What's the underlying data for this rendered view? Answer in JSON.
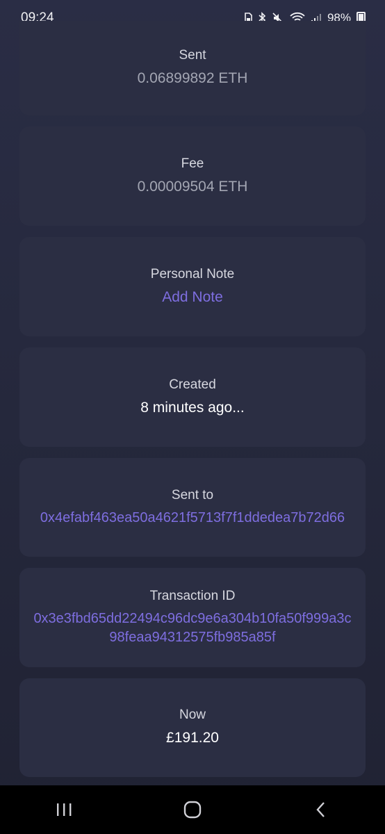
{
  "status_bar": {
    "time": "09:24",
    "battery": "98%"
  },
  "cards": {
    "sent": {
      "label": "Sent",
      "value": "0.06899892 ETH"
    },
    "fee": {
      "label": "Fee",
      "value": "0.00009504 ETH"
    },
    "note": {
      "label": "Personal Note",
      "value": "Add Note"
    },
    "created": {
      "label": "Created",
      "value": "8 minutes ago..."
    },
    "sent_to": {
      "label": "Sent to",
      "value": "0x4efabf463ea50a4621f5713f7f1ddedea7b72d66"
    },
    "tx_id": {
      "label": "Transaction ID",
      "value": "0x3e3fbd65dd22494c96dc9e6a304b10fa50f999a3c98feaa94312575fb985a85f"
    },
    "now": {
      "label": "Now",
      "value": "£191.20"
    }
  },
  "colors": {
    "accent_link": "#7e6ee0",
    "card_bg": "#2b2e43"
  },
  "nav_icons": [
    "recent-apps-icon",
    "home-icon",
    "back-icon"
  ]
}
